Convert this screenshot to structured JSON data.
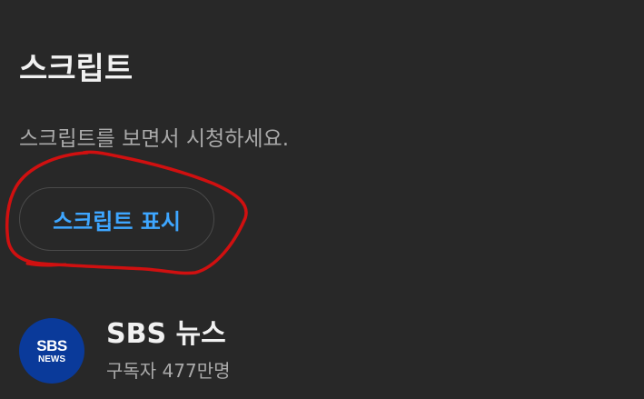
{
  "transcript_section": {
    "title": "스크립트",
    "description": "스크립트를 보면서 시청하세요.",
    "show_button_label": "스크립트 표시"
  },
  "channel": {
    "avatar_text_top": "SBS",
    "avatar_text_bottom": "NEWS",
    "name": "SBS 뉴스",
    "subscribers": "구독자 477만명"
  },
  "colors": {
    "background": "#282828",
    "button_text": "#3ea6ff",
    "annotation": "#d01010",
    "avatar_bg": "#0a3a9a"
  },
  "icons": {
    "annotation": "red-freehand-circle"
  }
}
